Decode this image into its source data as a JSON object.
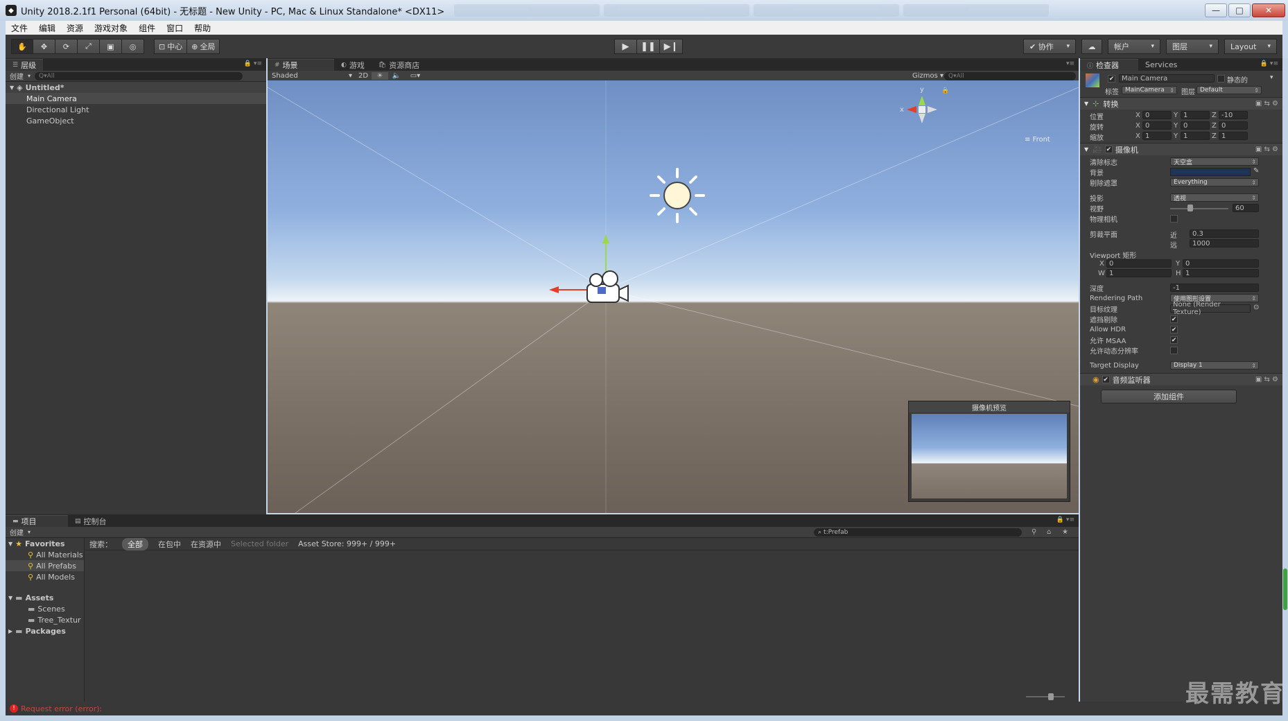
{
  "window": {
    "title": "Unity 2018.2.1f1 Personal (64bit) - 无标题 - New Unity - PC, Mac & Linux Standalone* <DX11>",
    "buttons": {
      "minimize": "—",
      "maximize": "□",
      "close": "✕"
    }
  },
  "menu": [
    "文件",
    "编辑",
    "资源",
    "游戏对象",
    "组件",
    "窗口",
    "帮助"
  ],
  "toolbar": {
    "pivot_label": "中心",
    "global_label": "全局",
    "collab_label": "协作",
    "account_label": "帐户",
    "layers_label": "图层",
    "layout_label": "Layout"
  },
  "hierarchy": {
    "tab_label": "层级",
    "create_label": "创建",
    "search_placeholder": "Q▾All",
    "scene_name": "Untitled*",
    "items": [
      "Main Camera",
      "Directional Light",
      "GameObject"
    ]
  },
  "scene": {
    "tabs": [
      "场景",
      "游戏",
      "资源商店"
    ],
    "shading_mode": "Shaded",
    "mode_2d": "2D",
    "gizmos_label": "Gizmos",
    "search_placeholder": "Q▾All",
    "view_label": "Front",
    "camera_preview_title": "摄像机预览",
    "axis_labels": {
      "x": "x",
      "y": "y"
    }
  },
  "inspector": {
    "tabs": [
      "检查器",
      "Services"
    ],
    "object_name": "Main Camera",
    "static_label": "静态的",
    "tag_label": "标签",
    "tag_value": "MainCamera",
    "layer_label": "图层",
    "layer_value": "Default",
    "transform": {
      "header": "转换",
      "position_label": "位置",
      "position": [
        "0",
        "1",
        "-10"
      ],
      "rotation_label": "旋转",
      "rotation": [
        "0",
        "0",
        "0"
      ],
      "scale_label": "缩放",
      "scale": [
        "1",
        "1",
        "1"
      ]
    },
    "camera": {
      "header": "摄像机",
      "clear_flags_label": "清除标志",
      "clear_flags_value": "天空盒",
      "background_label": "背景",
      "culling_mask_label": "剔除遮罩",
      "culling_mask_value": "Everything",
      "projection_label": "投影",
      "projection_value": "透视",
      "fov_label": "视野",
      "fov_value": "60",
      "physical_camera_label": "物理相机",
      "clipping_label": "剪裁平面",
      "near_label": "近",
      "near_value": "0.3",
      "far_label": "远",
      "far_value": "1000",
      "viewport_label": "Viewport 矩形",
      "viewport": {
        "x": "0",
        "y": "0",
        "w": "1",
        "h": "1"
      },
      "depth_label": "深度",
      "depth_value": "-1",
      "rendering_path_label": "Rendering Path",
      "rendering_path_value": "使用图形设置",
      "target_texture_label": "目标纹理",
      "target_texture_value": "None (Render Texture)",
      "occlusion_label": "遮挡剔除",
      "allow_hdr_label": "Allow HDR",
      "allow_msaa_label": "允许 MSAA",
      "dynamic_res_label": "允许动态分辨率",
      "target_display_label": "Target Display",
      "target_display_value": "Display 1"
    },
    "audio_listener_header": "音频监听器",
    "add_component_label": "添加组件"
  },
  "project": {
    "tabs": [
      "项目",
      "控制台"
    ],
    "create_label": "创建",
    "search_value": "t:Prefab",
    "favorites_label": "Favorites",
    "favorites": [
      "All Materials",
      "All Prefabs",
      "All Models"
    ],
    "assets_label": "Assets",
    "assets": [
      "Scenes",
      "Tree_Textur"
    ],
    "packages_label": "Packages",
    "filter_label": "搜索：",
    "filters": [
      "全部",
      "在包中",
      "在资源中"
    ],
    "selected_folder": "Selected folder",
    "asset_store_count": "Asset Store: 999+ / 999+"
  },
  "status": {
    "message": "Request error (error):"
  },
  "watermark": "最需教育",
  "colors": {
    "accent": "#3e6fbf",
    "camera_bg": "#1e3356",
    "error": "#cc2222",
    "panel": "#383838"
  }
}
